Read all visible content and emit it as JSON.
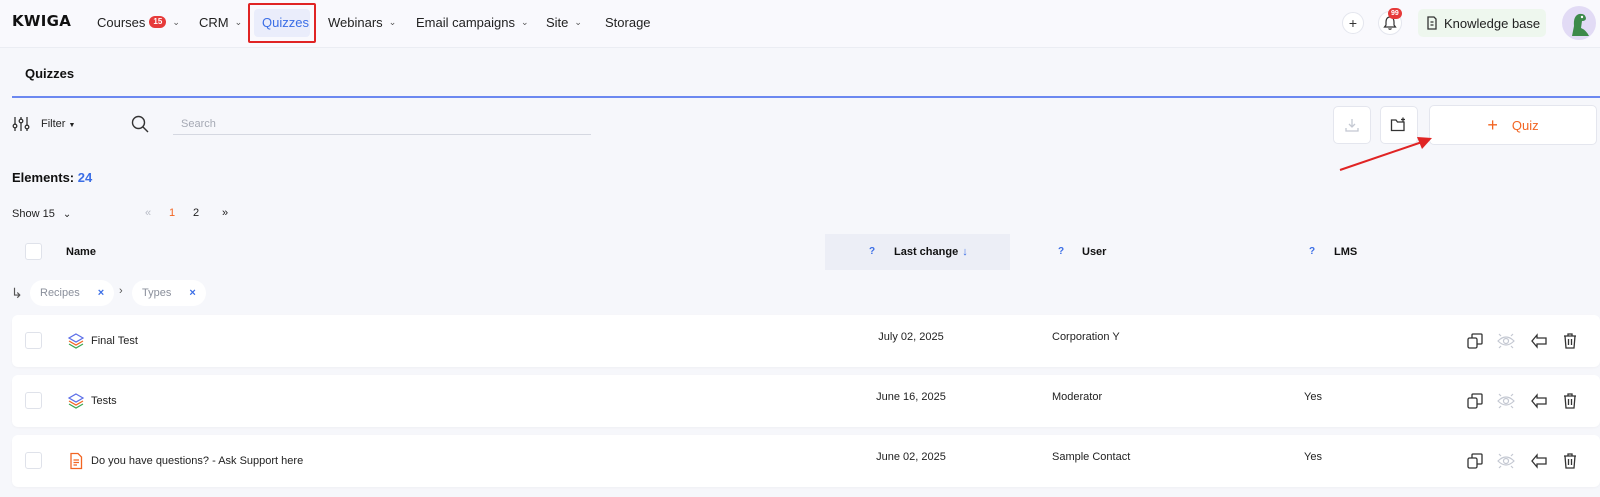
{
  "topnav": {
    "logo": "KWIGA",
    "items": [
      {
        "label": "Courses",
        "badge": "15",
        "has_dropdown": true
      },
      {
        "label": "CRM",
        "has_dropdown": true
      },
      {
        "label": "Quizzes",
        "active": true
      },
      {
        "label": "Webinars",
        "has_dropdown": true
      },
      {
        "label": "Email campaigns",
        "has_dropdown": true
      },
      {
        "label": "Site",
        "has_dropdown": true
      },
      {
        "label": "Storage"
      }
    ],
    "plus_label": "+",
    "notifications_badge": "99",
    "knowledge_base_label": "Knowledge base"
  },
  "page": {
    "title": "Quizzes"
  },
  "toolbar": {
    "filter_label": "Filter",
    "search_placeholder": "Search",
    "add_quiz_label": "Quiz"
  },
  "summary": {
    "elements_label": "Elements:",
    "elements_count": "24",
    "show_label": "Show 15",
    "pages": [
      "1",
      "2"
    ],
    "current_page": "1",
    "prev_label": "«",
    "next_label": "»"
  },
  "table": {
    "columns": {
      "name": "Name",
      "last_change": "Last change",
      "user": "User",
      "lms": "LMS",
      "help": "?"
    },
    "breadcrumb": [
      {
        "label": "Recipes",
        "remove": "×"
      },
      {
        "label": "Types",
        "remove": "×"
      }
    ],
    "rows": [
      {
        "name": "Final Test",
        "last_change": "July 02, 2025",
        "user": "Corporation Y",
        "lms": "",
        "icon": "stack-icon"
      },
      {
        "name": "Tests",
        "last_change": "June 16, 2025",
        "user": "Moderator",
        "lms": "Yes",
        "icon": "stack-icon"
      },
      {
        "name": "Do you have questions? - Ask Support here",
        "last_change": "June 02, 2025",
        "user": "Sample Contact",
        "lms": "Yes",
        "icon": "document-icon"
      }
    ]
  },
  "colors": {
    "accent_orange": "#f26522",
    "accent_blue": "#3b6ee6",
    "highlight_red": "#e02424"
  }
}
